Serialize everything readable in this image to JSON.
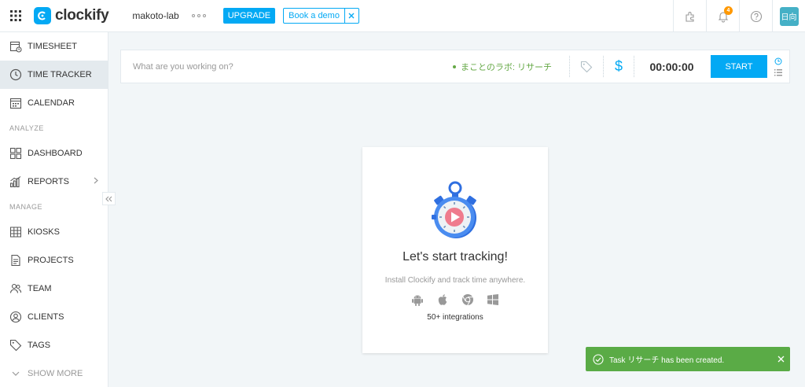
{
  "header": {
    "logo_text": "clockify",
    "workspace": "makoto-lab",
    "upgrade_label": "UPGRADE",
    "demo_label": "Book a demo",
    "notification_count": "4",
    "avatar_initials": "日向"
  },
  "sidebar": {
    "items_top": [
      {
        "label": "TIMESHEET",
        "icon": "timesheet-icon"
      },
      {
        "label": "TIME TRACKER",
        "icon": "clock-icon",
        "active": true
      },
      {
        "label": "CALENDAR",
        "icon": "calendar-icon"
      }
    ],
    "section_analyze": "ANALYZE",
    "items_analyze": [
      {
        "label": "DASHBOARD",
        "icon": "dashboard-icon"
      },
      {
        "label": "REPORTS",
        "icon": "reports-icon"
      }
    ],
    "section_manage": "MANAGE",
    "items_manage": [
      {
        "label": "KIOSKS",
        "icon": "kiosk-icon"
      },
      {
        "label": "PROJECTS",
        "icon": "projects-icon"
      },
      {
        "label": "TEAM",
        "icon": "team-icon"
      },
      {
        "label": "CLIENTS",
        "icon": "clients-icon"
      },
      {
        "label": "TAGS",
        "icon": "tag-icon"
      }
    ],
    "show_more": "SHOW MORE"
  },
  "tracker": {
    "placeholder": "What are you working on?",
    "project": "まことのラボ: リサーチ",
    "timer": "00:00:00",
    "start_label": "START"
  },
  "empty_state": {
    "title": "Let's start tracking!",
    "subtitle": "Install Clockify and track time anywhere.",
    "platforms": [
      "android-icon",
      "apple-icon",
      "chrome-icon",
      "windows-icon"
    ],
    "integrations": "50+ integrations"
  },
  "toast": {
    "message": "Task リサーチ has been created."
  },
  "colors": {
    "brand": "#03a9f4",
    "project_green": "#64a845",
    "toast_green": "#5aab46",
    "badge_orange": "#ff9800"
  }
}
